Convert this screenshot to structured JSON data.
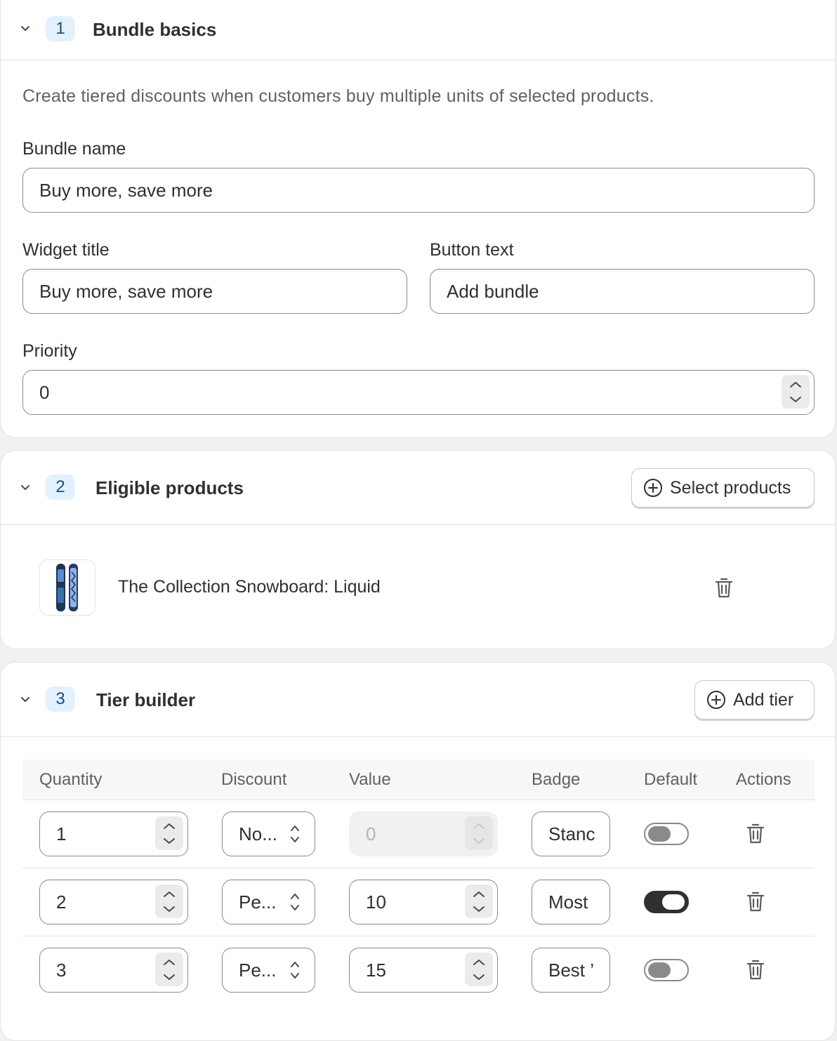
{
  "basics": {
    "step": "1",
    "title": "Bundle basics",
    "description": "Create tiered discounts when customers buy multiple units of selected products.",
    "bundle_name_label": "Bundle name",
    "bundle_name_value": "Buy more, save more",
    "widget_title_label": "Widget title",
    "widget_title_value": "Buy more, save more",
    "button_text_label": "Button text",
    "button_text_value": "Add bundle",
    "priority_label": "Priority",
    "priority_value": "0"
  },
  "products": {
    "step": "2",
    "title": "Eligible products",
    "select_button": "Select products",
    "items": [
      {
        "name": "The Collection Snowboard: Liquid",
        "thumbnail_icon": "snowboard-image"
      }
    ]
  },
  "tiers": {
    "step": "3",
    "title": "Tier builder",
    "add_button": "Add tier",
    "columns": [
      "Quantity",
      "Discount",
      "Value",
      "Badge",
      "Default",
      "Actions"
    ],
    "rows": [
      {
        "quantity": "1",
        "discount": "No...",
        "value": "0",
        "value_disabled": true,
        "badge": "Stanc",
        "default": false
      },
      {
        "quantity": "2",
        "discount": "Pe...",
        "value": "10",
        "value_disabled": false,
        "badge": "Most",
        "default": true
      },
      {
        "quantity": "3",
        "discount": "Pe...",
        "value": "15",
        "value_disabled": false,
        "badge": "Best ’",
        "default": false
      }
    ]
  },
  "colors": {
    "step_badge_bg": "#e3f1fd",
    "step_badge_text": "#1a4e7a",
    "toggle_on": "#303030",
    "border": "#8a8a8a"
  }
}
